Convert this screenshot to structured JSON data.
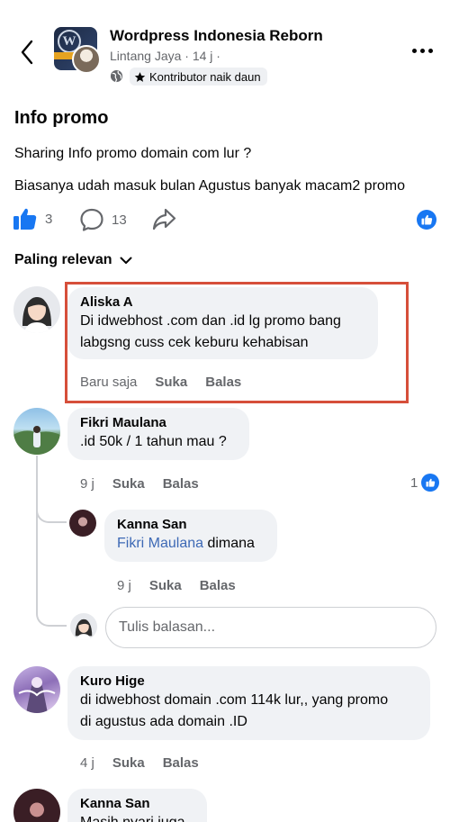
{
  "header": {
    "group_name": "Wordpress Indonesia Reborn",
    "post_meta": "Lintang Jaya · 14 j ·",
    "badge_label": "Kontributor naik daun",
    "icons": [
      "back-arrow-icon",
      "globe-icon",
      "star-icon",
      "more-icon"
    ]
  },
  "post": {
    "title": "Info promo",
    "lines": [
      "Sharing Info promo domain com lur ?",
      "Biasanya udah masuk bulan Agustus banyak macam2 promo"
    ],
    "like_count": "3",
    "comment_count": "13"
  },
  "sort": {
    "label": "Paling relevan"
  },
  "comments": [
    {
      "author": "Aliska A",
      "lines": [
        "Di idwebhost .com dan .id lg promo bang",
        "labgsng cuss cek keburu kehabisan"
      ],
      "time": "Baru saja",
      "like_label": "Suka",
      "reply_label": "Balas"
    },
    {
      "author": "Fikri Maulana",
      "lines": [
        ".id 50k / 1 tahun mau ?"
      ],
      "time": "9 j",
      "like_label": "Suka",
      "reply_label": "Balas",
      "reaction_count": "1",
      "replies": [
        {
          "author": "Kanna San",
          "mention": "Fikri Maulana",
          "text": " dimana",
          "time": "9 j",
          "like_label": "Suka",
          "reply_label": "Balas"
        }
      ]
    },
    {
      "author": "Kuro Hige",
      "lines": [
        "di idwebhost  domain .com 114k lur,, yang promo",
        "di agustus ada domain .ID"
      ],
      "time": "4 j",
      "like_label": "Suka",
      "reply_label": "Balas"
    },
    {
      "author": "Kanna San",
      "lines": [
        "Masih nyari juga"
      ]
    }
  ],
  "reply_input": {
    "placeholder": "Tulis balasan..."
  },
  "colors": {
    "accent": "#1877f2",
    "highlight": "#d64f3a",
    "bubble": "#f0f2f5",
    "muted": "#65676b"
  }
}
